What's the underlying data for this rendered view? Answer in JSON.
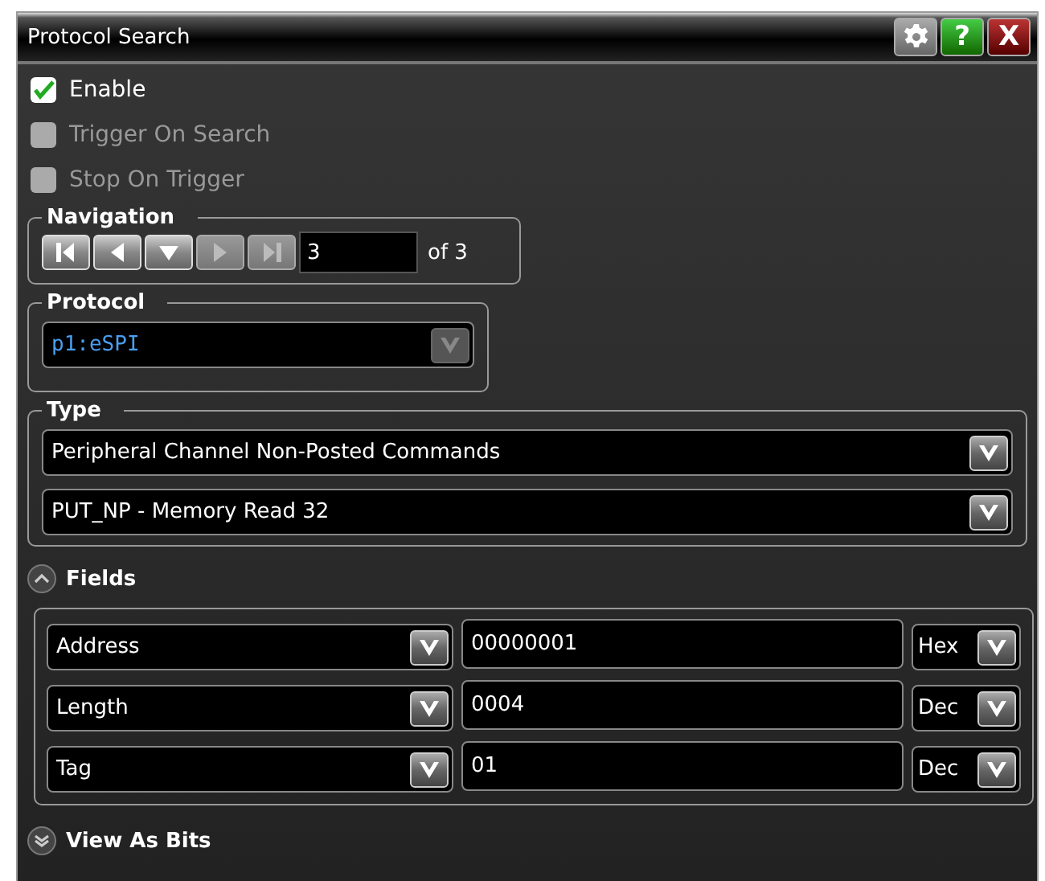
{
  "window": {
    "title": "Protocol Search"
  },
  "title_buttons": [
    {
      "kind": "settings"
    },
    {
      "kind": "help",
      "label": "?"
    },
    {
      "kind": "close",
      "label": "X"
    }
  ],
  "options": [
    {
      "label": "Enable",
      "checked": true,
      "disabled": false
    },
    {
      "label": "Trigger On Search",
      "checked": false,
      "disabled": true
    },
    {
      "label": "Stop On Trigger",
      "checked": false,
      "disabled": true
    }
  ],
  "navigation": {
    "label": "Navigation",
    "buttons": [
      {
        "kind": "first",
        "disabled": false
      },
      {
        "kind": "previous",
        "disabled": false
      },
      {
        "kind": "current",
        "disabled": false
      },
      {
        "kind": "next",
        "disabled": true
      },
      {
        "kind": "last",
        "disabled": true
      }
    ],
    "value": "3",
    "total": "of 3"
  },
  "protocol": {
    "label": "Protocol",
    "value": "p1:eSPI",
    "disabled": true
  },
  "type": {
    "label": "Type",
    "dropdowns": [
      {
        "value": "Peripheral Channel Non-Posted Commands"
      },
      {
        "value": "PUT_NP - Memory Read 32"
      }
    ]
  },
  "sections": [
    {
      "label": "Fields",
      "expanded": true,
      "rows": [
        {
          "field": "Address",
          "value": "00000001",
          "format": "Hex"
        },
        {
          "field": "Length",
          "value": "0004",
          "format": "Dec"
        },
        {
          "field": "Tag",
          "value": "01",
          "format": "Dec"
        }
      ]
    },
    {
      "label": "View As Bits",
      "expanded": false
    }
  ]
}
